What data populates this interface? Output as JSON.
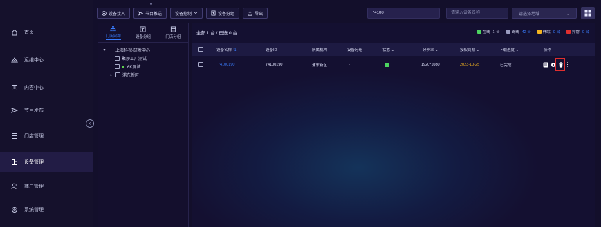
{
  "sidebar": {
    "items": [
      {
        "label": "首页",
        "icon": "home-icon"
      },
      {
        "label": "运维中心",
        "icon": "ops-icon"
      },
      {
        "label": "内容中心",
        "icon": "content-icon"
      },
      {
        "label": "节目发布",
        "icon": "send-icon"
      },
      {
        "label": "门店管理",
        "icon": "store-icon"
      },
      {
        "label": "设备管理",
        "icon": "device-icon",
        "active": true
      },
      {
        "label": "商户管理",
        "icon": "merchant-icon"
      },
      {
        "label": "系统管理",
        "icon": "settings-icon"
      }
    ],
    "collapse_glyph": "‹"
  },
  "toolbar": {
    "buttons": [
      {
        "label": "设备接入",
        "icon": "plus-circle-icon"
      },
      {
        "label": "节目推送",
        "icon": "send-icon"
      },
      {
        "label": "设备控制",
        "icon": "chevron-down-icon"
      },
      {
        "label": "设备分组",
        "icon": "group-icon"
      },
      {
        "label": "导出",
        "icon": "export-icon"
      }
    ],
    "search_value": "74100",
    "name_placeholder": "请输入设备名称",
    "region_placeholder": "请选择地域",
    "region_arrow": "⌄"
  },
  "tree": {
    "tabs": [
      {
        "label": "门店架构",
        "icon": "org-tree-icon",
        "active": true
      },
      {
        "label": "设备分组",
        "icon": "device-group-icon"
      },
      {
        "label": "门店分组",
        "icon": "store-group-icon"
      }
    ],
    "nodes": [
      {
        "label": "上海科视-研发中心",
        "level": 0,
        "expanded": true
      },
      {
        "label": "聚沙工厂测试",
        "level": 1
      },
      {
        "label": "6K测试",
        "level": 1,
        "dot": true
      },
      {
        "label": "浦东新区",
        "level": 1,
        "collapsed": true
      }
    ],
    "caret_expanded": "▼",
    "caret_collapsed": "▸"
  },
  "main": {
    "summary": "全部 1 台 / 已选 0 台",
    "legend": [
      {
        "label": "在线",
        "count": "1 台",
        "color": "#4cd460"
      },
      {
        "label": "离线",
        "count": "42 台",
        "color": "#9a9cc0",
        "count_color": "#3a7dff"
      },
      {
        "label": "休眠",
        "count": "0 台",
        "color": "#f5b51f",
        "count_color": "#3a7dff"
      },
      {
        "label": "异常",
        "count": "0 台",
        "color": "#e02f2f",
        "count_color": "#3a7dff"
      }
    ],
    "columns": [
      "设备名称",
      "设备ID",
      "所属机构",
      "设备分组",
      "状态",
      "分辨率",
      "授权到期",
      "下载进度",
      "操作"
    ],
    "sort_glyph": "⇅",
    "filter_glyph": "⌄",
    "rows": [
      {
        "name": "74100190",
        "device_id": "74100190",
        "org": "浦东新区",
        "group": "-",
        "status": "online",
        "resolution": "1920*1080",
        "expiry": "2023-10-25",
        "progress": "已完成"
      }
    ],
    "actions": [
      "preview-icon",
      "settings-icon",
      "delete-icon",
      "more-icon"
    ],
    "more_glyph": "⋮"
  },
  "colors": {
    "accent": "#3a7dff",
    "online": "#4cd460",
    "warning": "#f5b51f",
    "danger": "#e02f2f",
    "sidebar_bg": "#15112c",
    "active_bg": "#221c45"
  }
}
